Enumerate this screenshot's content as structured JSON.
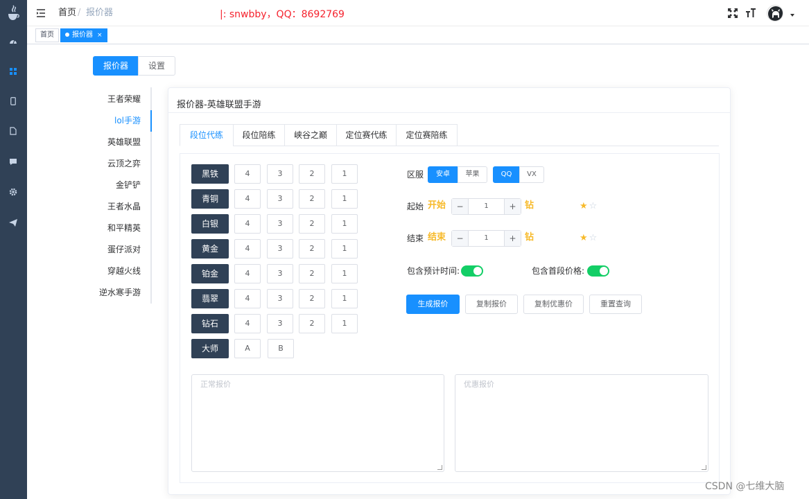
{
  "navbar": {
    "breadcrumb_home": "首页",
    "breadcrumb_separator": "/",
    "breadcrumb_current": "报价器",
    "notice": "|: snwbby，QQ：8692769"
  },
  "tags": {
    "home": "首页",
    "current": "报价器",
    "close": "×"
  },
  "top_tabs": {
    "quote": "报价器",
    "settings": "设置"
  },
  "games": [
    {
      "label": "王者荣耀"
    },
    {
      "label": "lol手游"
    },
    {
      "label": "英雄联盟"
    },
    {
      "label": "云顶之弈"
    },
    {
      "label": "金铲铲"
    },
    {
      "label": "王者水晶"
    },
    {
      "label": "和平精英"
    },
    {
      "label": "蛋仔派对"
    },
    {
      "label": "穿越火线"
    },
    {
      "label": "逆水寒手游"
    }
  ],
  "active_game_index": 1,
  "card": {
    "title": "报价器-英雄联盟手游",
    "tabs": [
      {
        "label": "段位代练"
      },
      {
        "label": "段位陪练"
      },
      {
        "label": "峡谷之巅"
      },
      {
        "label": "定位赛代练"
      },
      {
        "label": "定位赛陪练"
      }
    ]
  },
  "ranks": [
    {
      "name": "黑铁",
      "levels": [
        "4",
        "3",
        "2",
        "1"
      ]
    },
    {
      "name": "青铜",
      "levels": [
        "4",
        "3",
        "2",
        "1"
      ]
    },
    {
      "name": "白银",
      "levels": [
        "4",
        "3",
        "2",
        "1"
      ]
    },
    {
      "name": "黄金",
      "levels": [
        "4",
        "3",
        "2",
        "1"
      ]
    },
    {
      "name": "铂金",
      "levels": [
        "4",
        "3",
        "2",
        "1"
      ]
    },
    {
      "name": "翡翠",
      "levels": [
        "4",
        "3",
        "2",
        "1"
      ]
    },
    {
      "name": "钻石",
      "levels": [
        "4",
        "3",
        "2",
        "1"
      ]
    },
    {
      "name": "大师",
      "levels": [
        "A",
        "B"
      ]
    }
  ],
  "form": {
    "server_label": "区服",
    "platform_options": [
      "安卓",
      "苹果"
    ],
    "platform_selected": "安卓",
    "account_options": [
      "QQ",
      "VX"
    ],
    "account_selected": "QQ",
    "start_label": "起始",
    "start_hint": "开始",
    "start_value": "1",
    "start_rank": "钻",
    "start_stars": 1,
    "end_label": "结束",
    "end_hint": "结束",
    "end_value": "1",
    "end_rank": "钻",
    "end_stars": 1,
    "stars_max": 2,
    "minus": "−",
    "plus": "+",
    "include_time_label": "包含预计时间:",
    "include_time_on": true,
    "include_first_label": "包含首段价格:",
    "include_first_on": true
  },
  "buttons": {
    "generate": "生成报价",
    "copy": "复制报价",
    "copy_discount": "复制优惠价",
    "reset": "重置查询"
  },
  "textareas": {
    "normal_placeholder": "正常报价",
    "discount_placeholder": "优惠报价"
  },
  "watermark": "CSDN @七维大脑",
  "colors": {
    "sidebar": "#304156",
    "primary": "#1890ff",
    "rank_button": "#304156",
    "switch_on": "#13ce66",
    "gold": "#f7ba2a",
    "notice": "#f5222d"
  }
}
